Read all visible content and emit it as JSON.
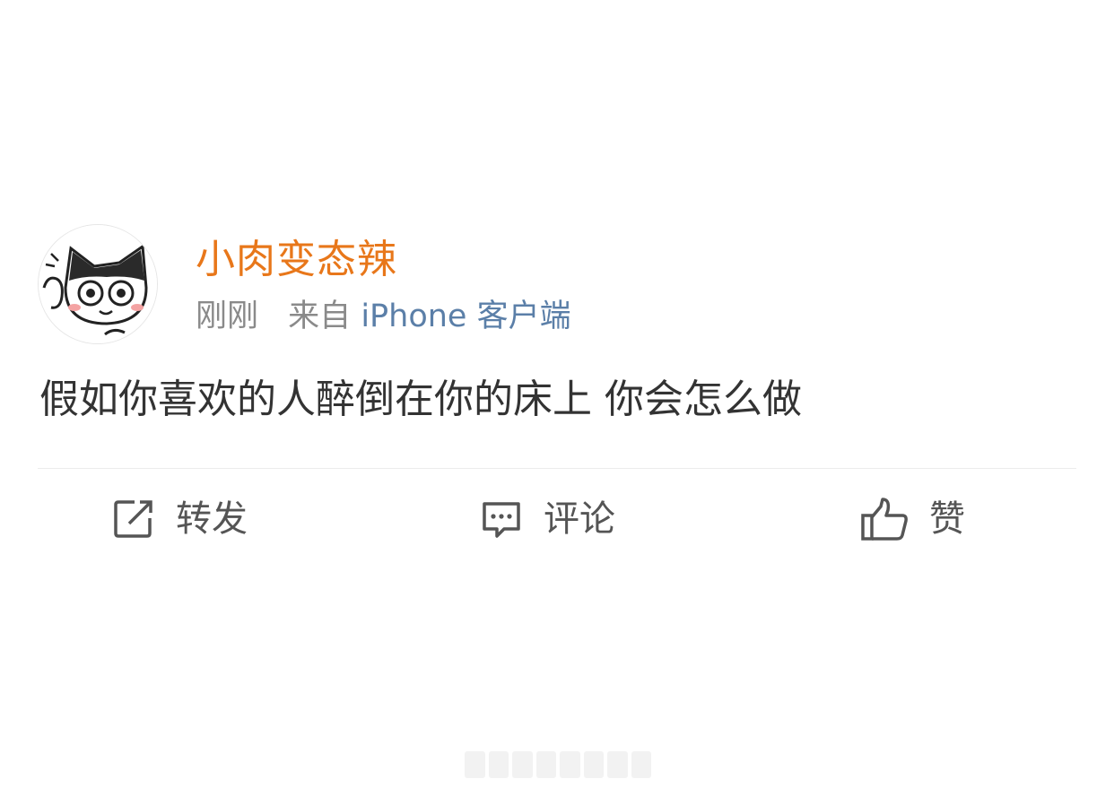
{
  "post": {
    "username": "小肉变态辣",
    "time": "刚刚",
    "source_prefix": "来自",
    "source_client": "iPhone 客户端",
    "text": "假如你喜欢的人醉倒在你的床上 你会怎么做"
  },
  "actions": {
    "repost": {
      "label": "转发",
      "icon": "share-icon"
    },
    "comment": {
      "label": "评论",
      "icon": "comment-icon"
    },
    "like": {
      "label": "赞",
      "icon": "thumbs-up-icon"
    }
  },
  "colors": {
    "username": "#e8771a",
    "meta": "#8a8a8a",
    "client_link": "#5b7fa8",
    "body_text": "#333333",
    "action_text": "#555555"
  }
}
